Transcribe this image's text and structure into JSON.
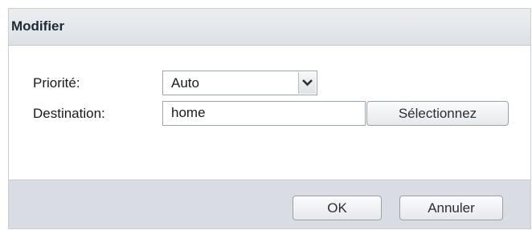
{
  "dialog": {
    "title": "Modifier"
  },
  "form": {
    "priority_label": "Priorité:",
    "priority_value": "Auto",
    "destination_label": "Destination:",
    "destination_value": "home",
    "select_button_label": "Sélectionnez"
  },
  "footer": {
    "ok_label": "OK",
    "cancel_label": "Annuler"
  },
  "icons": {
    "dropdown": "chevron-down-icon"
  }
}
